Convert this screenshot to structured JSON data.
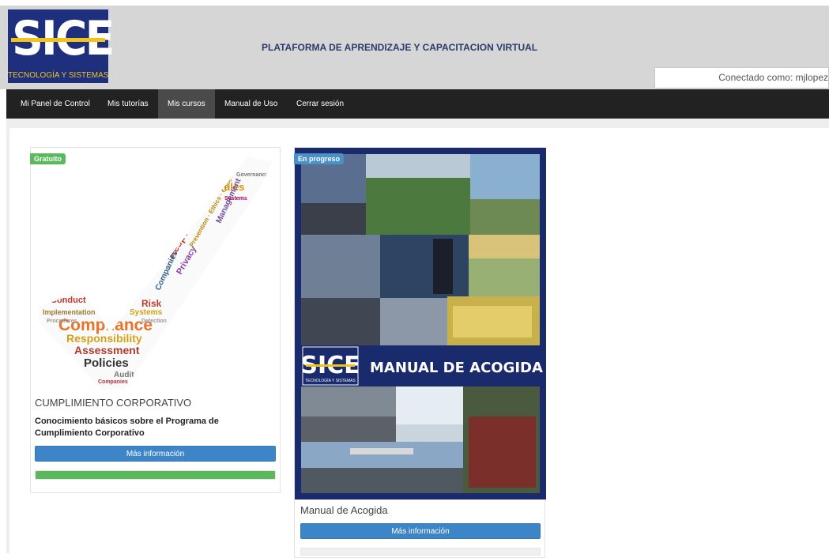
{
  "header": {
    "logo_text": "SICE",
    "logo_subtitle": "TECNOLOGÍA Y SISTEMAS",
    "platform_title": "PLATAFORMA DE APRENDIZAJE Y CAPACITACION VIRTUAL",
    "connected_as": "Conectado como: mjlopez"
  },
  "nav": {
    "items": [
      {
        "label": "Mi Panel de Control",
        "active": false
      },
      {
        "label": "Mis tutorías",
        "active": false
      },
      {
        "label": "Mis cursos",
        "active": true
      },
      {
        "label": "Manual de Uso",
        "active": false
      },
      {
        "label": "Cerrar sesión",
        "active": false
      }
    ]
  },
  "courses": [
    {
      "badge": "Gratuito",
      "badge_color": "#5cb85c",
      "image_alt": "compliance word cloud checkmark",
      "word_cloud": [
        "Compliance",
        "Responsibility",
        "Assessment",
        "Policies",
        "Audit",
        "Laws",
        "Respect",
        "Privacy",
        "Rules",
        "Risk",
        "Systems",
        "Conduct",
        "Management",
        "Companies"
      ],
      "title": "CUMPLIMIENTO CORPORATIVO",
      "description": "Conocimiento básicos sobre el Programa de Cumplimiento Corporativo",
      "button_label": "Más información",
      "progress": 1.0
    },
    {
      "badge": "En progreso",
      "badge_color": "#4a90c9",
      "image_alt": "manual de acogida cover collage",
      "cover_logo": "SICE",
      "cover_logo_sub": "TECNOLOGÍA Y SISTEMAS",
      "cover_title": "MANUAL DE ACOGIDA",
      "title": "Manual de Acogida",
      "button_label": "Más información",
      "progress": 0.0
    }
  ],
  "colors": {
    "header_bg": "#d6d6d6",
    "logo_bg": "#1e2f7d",
    "logo_accent": "#f2c417",
    "nav_bg": "#222222",
    "button_blue": "#3d85c6",
    "progress_green": "#5cb85c"
  }
}
